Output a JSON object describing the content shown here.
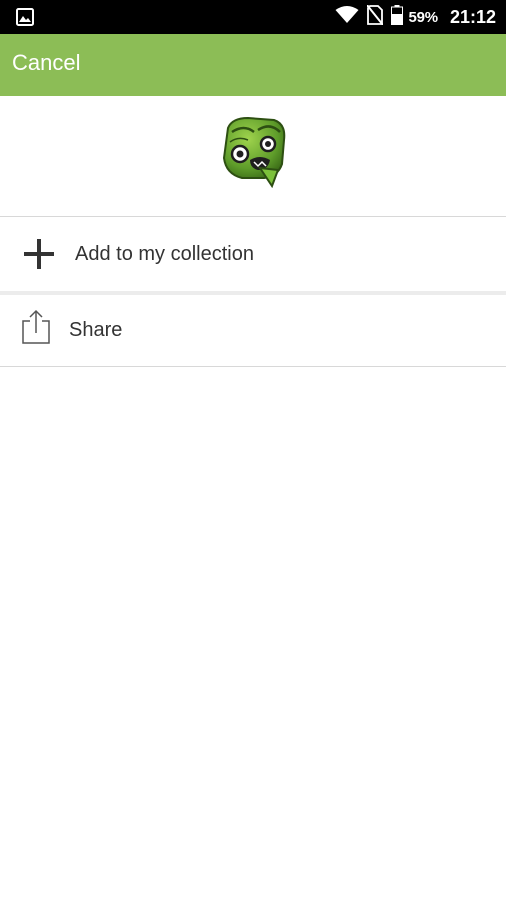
{
  "status_bar": {
    "notification_icon": "image-icon",
    "wifi_icon": "wifi-icon",
    "signal_icon": "no-sim-icon",
    "battery_icon": "battery-icon",
    "battery_percent": "59%",
    "time": "21:12"
  },
  "app_bar": {
    "cancel_label": "Cancel",
    "color": "#8cbd56"
  },
  "header": {
    "sticker_icon": "green-tiki-face-sticker"
  },
  "menu": {
    "items": [
      {
        "icon": "plus-icon",
        "label": "Add to my collection"
      },
      {
        "icon": "share-icon",
        "label": "Share"
      }
    ]
  }
}
